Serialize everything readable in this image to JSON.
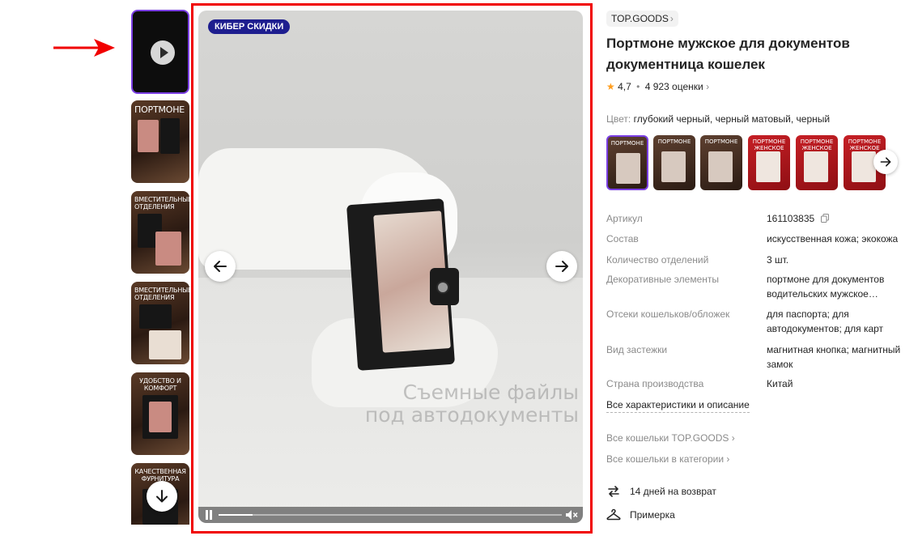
{
  "media": {
    "badge": "КИБЕР СКИДКИ",
    "watermark_line1": "Съемные файлы",
    "watermark_line2": "под автодокументы",
    "video_progress": 0.1
  },
  "thumbnails": [
    {
      "type": "video",
      "title": ""
    },
    {
      "type": "photo",
      "title": "ПОРТМОНЕ"
    },
    {
      "type": "photo",
      "title": "ВМЕСТИТЕЛЬНЫЕ ОТДЕЛЕНИЯ"
    },
    {
      "type": "photo",
      "title": "ВМЕСТИТЕЛЬНЫЕ ОТДЕЛЕНИЯ"
    },
    {
      "type": "photo",
      "title": "УДОБСТВО И КОМФОРТ"
    },
    {
      "type": "photo",
      "title": "КАЧЕСТВЕННАЯ ФУРНИТУРА"
    }
  ],
  "product": {
    "brand": "TOP.GOODS",
    "title": "Портмоне мужское для документов документница кошелек",
    "rating": "4,7",
    "reviews": "4 923 оценки",
    "color_label": "Цвет:",
    "color_value": "глубокий черный, черный матовый, черный"
  },
  "swatches": [
    {
      "label": "ПОРТМОНЕ",
      "style": "dark",
      "selected": true
    },
    {
      "label": "ПОРТМОНЕ",
      "style": "dark",
      "selected": false
    },
    {
      "label": "ПОРТМОНЕ",
      "style": "dark",
      "selected": false
    },
    {
      "label": "ПОРТМОНЕ ЖЕНСКОЕ",
      "style": "red",
      "selected": false
    },
    {
      "label": "ПОРТМОНЕ ЖЕНСКОЕ",
      "style": "red",
      "selected": false
    },
    {
      "label": "ПОРТМОНЕ ЖЕНСКОЕ",
      "style": "red",
      "selected": false
    }
  ],
  "specs": [
    {
      "key": "Артикул",
      "value": "161103835"
    },
    {
      "key": "Состав",
      "value": "искусственная кожа; экокожа"
    },
    {
      "key": "Количество отделений",
      "value": "3 шт."
    },
    {
      "key": "Декоративные элементы",
      "value": "портмоне для документов водительских мужское…"
    },
    {
      "key": "Отсеки кошельков/обложек",
      "value": "для паспорта; для автодокументов; для карт"
    },
    {
      "key": "Вид застежки",
      "value": "магнитная кнопка; магнитный замок"
    },
    {
      "key": "Страна производства",
      "value": "Китай"
    }
  ],
  "links": {
    "all_specs": "Все характеристики и описание",
    "brand_wallets": "Все кошельки TOP.GOODS",
    "category_wallets": "Все кошельки в категории"
  },
  "services": {
    "return": "14 дней на возврат",
    "fitting": "Примерка"
  },
  "icons": {
    "play": "play-icon",
    "arrow_down": "arrow-down-icon",
    "arrow_left": "arrow-left-icon",
    "arrow_right": "arrow-right-icon",
    "copy": "copy-icon",
    "return": "return-icon",
    "hanger": "hanger-icon",
    "star": "star-icon",
    "mute": "mute-icon"
  },
  "colors": {
    "accent": "#7b3fe4",
    "annotation": "#f10000",
    "badge": "#1e1e8f",
    "star": "#ff9d1c"
  }
}
